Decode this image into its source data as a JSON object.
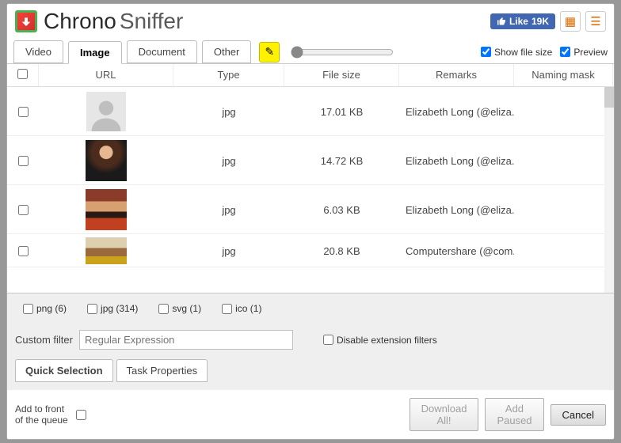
{
  "header": {
    "title_main": "Chrono",
    "title_sub": "Sniffer",
    "like_label": "Like",
    "like_count": "19K"
  },
  "tabs": {
    "items": [
      {
        "label": "Video"
      },
      {
        "label": "Image"
      },
      {
        "label": "Document"
      },
      {
        "label": "Other"
      }
    ],
    "active_index": 1
  },
  "options": {
    "show_file_size": "Show file size",
    "preview": "Preview"
  },
  "columns": {
    "url": "URL",
    "type": "Type",
    "filesize": "File size",
    "remarks": "Remarks",
    "mask": "Naming mask"
  },
  "rows": [
    {
      "type": "jpg",
      "size": "17.01 KB",
      "remarks": "Elizabeth Long (@eliza...",
      "thumb": "placeholder"
    },
    {
      "type": "jpg",
      "size": "14.72 KB",
      "remarks": "Elizabeth Long (@eliza...",
      "thumb": "p1"
    },
    {
      "type": "jpg",
      "size": "6.03 KB",
      "remarks": "Elizabeth Long (@eliza...",
      "thumb": "p2"
    },
    {
      "type": "jpg",
      "size": "20.8 KB",
      "remarks": "Computershare (@com...",
      "thumb": "p3"
    }
  ],
  "filters": {
    "items": [
      {
        "label": "png (6)"
      },
      {
        "label": "jpg (314)"
      },
      {
        "label": "svg (1)"
      },
      {
        "label": "ico (1)"
      }
    ],
    "custom_label": "Custom filter",
    "custom_placeholder": "Regular Expression",
    "disable_ext": "Disable extension filters"
  },
  "bottom_tabs": {
    "quick": "Quick Selection",
    "task": "Task Properties"
  },
  "footer": {
    "add_front": "Add to front of the queue",
    "download_all": "Download All!",
    "add_paused": "Add Paused",
    "cancel": "Cancel"
  }
}
